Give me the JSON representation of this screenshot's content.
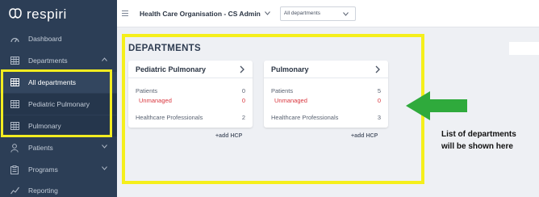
{
  "brand": {
    "name": "respiri"
  },
  "sidebar": {
    "items": [
      {
        "label": "Dashboard",
        "icon": "dashboard-icon"
      },
      {
        "label": "Departments",
        "icon": "building-icon"
      },
      {
        "label": "All departments",
        "icon": "building-icon"
      },
      {
        "label": "Pediatric Pulmonary",
        "icon": "building-icon"
      },
      {
        "label": "Pulmonary",
        "icon": "building-icon"
      },
      {
        "label": "Patients",
        "icon": "user-icon"
      },
      {
        "label": "Programs",
        "icon": "clipboard-icon"
      },
      {
        "label": "Reporting",
        "icon": "chart-line-icon"
      }
    ]
  },
  "topbar": {
    "organisation": "Health Care Organisation - CS Admin",
    "department_select": "All departments"
  },
  "main": {
    "title": "DEPARTMENTS",
    "cards": [
      {
        "name": "Pediatric Pulmonary",
        "patients_label": "Patients",
        "patients": "0",
        "unmanaged_label": "Unmanaged",
        "unmanaged": "0",
        "hcp_label": "Healthcare Professionals",
        "hcp": "2",
        "add_label": "+add HCP"
      },
      {
        "name": "Pulmonary",
        "patients_label": "Patients",
        "patients": "5",
        "unmanaged_label": "Unmanaged",
        "unmanaged": "0",
        "hcp_label": "Healthcare Professionals",
        "hcp": "3",
        "add_label": "+add HCP"
      }
    ]
  },
  "annotation": {
    "line1": "List of departments",
    "line2": "will be shown here"
  },
  "colors": {
    "sidebar": "#2c3e56",
    "highlight": "#f5ef1b",
    "arrow": "#2faa3c",
    "alert": "#d9363e"
  }
}
